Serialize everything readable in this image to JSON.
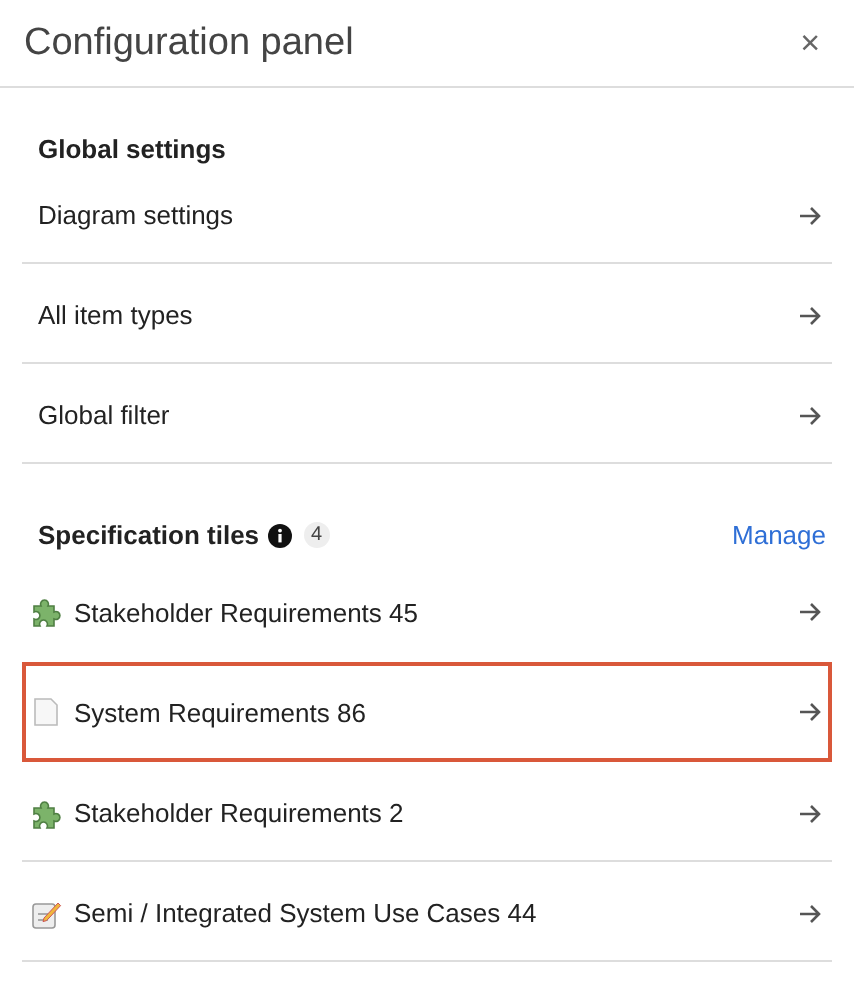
{
  "panel": {
    "title": "Configuration panel",
    "close": "×"
  },
  "global_settings": {
    "heading": "Global settings",
    "items": [
      {
        "label": "Diagram settings"
      },
      {
        "label": "All item types"
      },
      {
        "label": "Global filter"
      }
    ]
  },
  "specification_tiles": {
    "heading": "Specification tiles",
    "count": "4",
    "action": "Manage",
    "items": [
      {
        "label": "Stakeholder Requirements 45",
        "kind": "puzzle",
        "selected": false
      },
      {
        "label": "System Requirements 86",
        "kind": "document",
        "selected": true
      },
      {
        "label": "Stakeholder Requirements 2",
        "kind": "puzzle",
        "selected": false
      },
      {
        "label": "Semi / Integrated System Use Cases 44",
        "kind": "form",
        "selected": false
      }
    ]
  }
}
